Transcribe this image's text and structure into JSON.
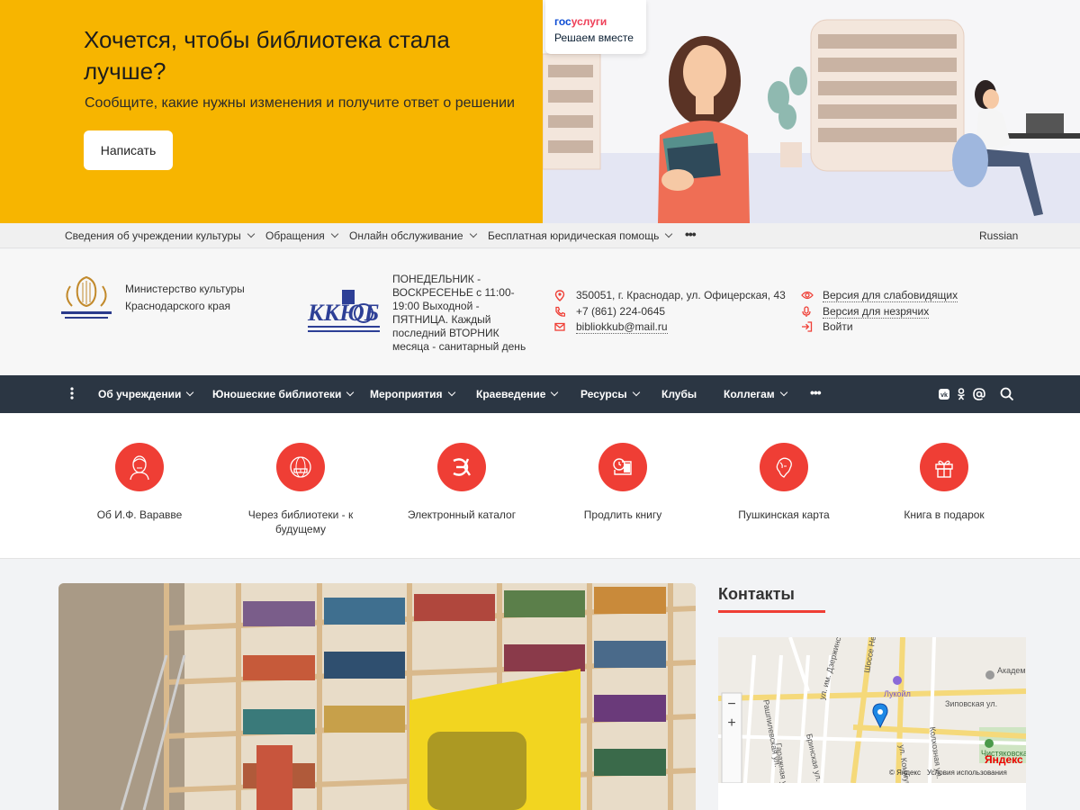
{
  "banner": {
    "title": "Хочется, чтобы библиотека стала лучше?",
    "subtitle": "Сообщите, какие нужны изменения и получите ответ о решении",
    "button": "Написать",
    "gosuslugi_part1": "гос",
    "gosuslugi_part2": "услуги",
    "gosuslugi_sub": "Решаем вместе",
    "bg_color": "#f7b500"
  },
  "topbar": {
    "items": [
      {
        "label": "Сведения об учреждении культуры"
      },
      {
        "label": "Обращения"
      },
      {
        "label": "Онлайн обслуживание"
      },
      {
        "label": "Бесплатная юридическая помощь"
      }
    ],
    "more": "•••",
    "language": "Russian"
  },
  "header": {
    "ministry": "Министерство культуры Краснодарского края",
    "schedule": "ПОНЕДЕЛЬНИК - ВОСКРЕСЕНЬЕ с 11:00-19:00 Выходной - ПЯТНИЦА. Каждый последний ВТОРНИК месяца - санитарный день",
    "address": "350051, г. Краснодар, ул. Офицерская, 43",
    "phone": "+7 (861) 224-0645",
    "email": "bibliokkub@mail.ru",
    "accessibility": {
      "low_vision": "Версия для слабовидящих",
      "blind": "Версия для незрячих",
      "login": "Войти"
    }
  },
  "nav": {
    "items": [
      {
        "label": "Об учреждении",
        "dropdown": true
      },
      {
        "label": "Юношеские библиотеки",
        "dropdown": true
      },
      {
        "label": "Мероприятия",
        "dropdown": true
      },
      {
        "label": "Краеведение",
        "dropdown": true
      },
      {
        "label": "Ресурсы",
        "dropdown": true
      },
      {
        "label": "Клубы",
        "dropdown": false
      },
      {
        "label": "Коллегам",
        "dropdown": true
      }
    ],
    "more": "•••",
    "bg_color": "#2b3643"
  },
  "quick_links": [
    {
      "label": "Об И.Ф. Варавве",
      "icon": "portrait-icon"
    },
    {
      "label": "Через библиотеки - к будущему",
      "icon": "books-globe-icon"
    },
    {
      "label": "Электронный каталог",
      "icon": "catalog-letter-icon"
    },
    {
      "label": "Продлить книгу",
      "icon": "book-clock-icon"
    },
    {
      "label": "Пушкинская карта",
      "icon": "pushkin-icon"
    },
    {
      "label": "Книга в подарок",
      "icon": "gift-icon"
    }
  ],
  "accent_color": "#ef3e35",
  "contacts": {
    "title": "Контакты",
    "map": {
      "streets": [
        "Шоссе Нефтяников",
        "ул. им. Дзержинского",
        "Зиповская ул.",
        "Рашпилевская ул.",
        "Бринская ул.",
        "Гаражная ул.",
        "Колхозная ул.",
        "ул. Коммунаров"
      ],
      "poi": [
        "Лукойл",
        "Академ. коллед.",
        "Чистяковская роща"
      ],
      "brand": "Яндекс",
      "copyright": "© Яндекс",
      "terms": "Условия использования",
      "zoom_in": "+",
      "zoom_out": "−"
    }
  }
}
